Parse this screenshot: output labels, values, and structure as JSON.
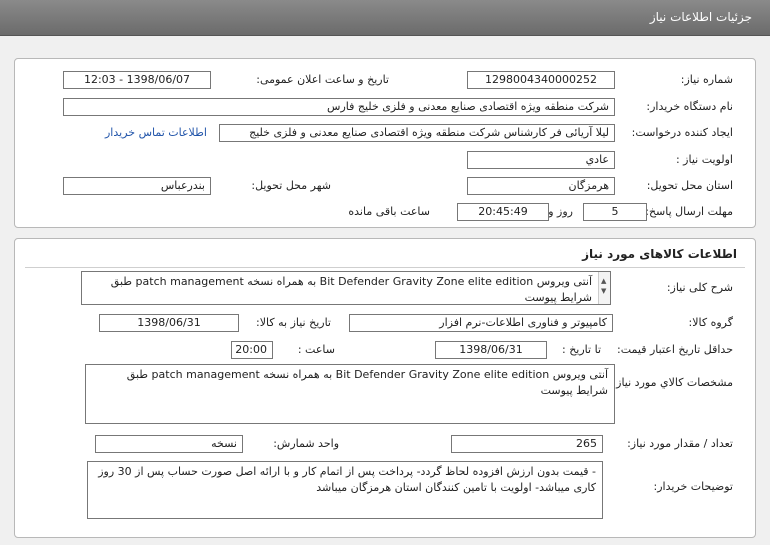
{
  "title": "جزئیات اطلاعات نیاز",
  "need_info": {
    "need_number_label": "شماره نیاز:",
    "need_number": "1298004340000252",
    "announce_label": "تاریخ و ساعت اعلان عمومی:",
    "announce_value": "1398/06/07 - 12:03",
    "buyer_label": "نام دستگاه خریدار:",
    "buyer_value": "شرکت منطقه ویژه اقتصادی صنایع معدنی و فلزی خلیج فارس",
    "creator_label": "ایجاد کننده درخواست:",
    "creator_value": "لیلا آریائی فر کارشناس شرکت منطقه ویژه اقتصادی صنایع معدنی و فلزی خلیج",
    "contact_link": "اطلاعات تماس خریدار",
    "priority_label": "اولویت نیاز :",
    "priority_value": "عادي",
    "province_label": "استان محل تحویل:",
    "province_value": "هرمزگان",
    "city_label": "شهر محل تحویل:",
    "city_value": "بندرعباس",
    "deadline_label": "مهلت ارسال پاسخ:",
    "deadline_days": "5",
    "days_word": "روز و",
    "deadline_time": "20:45:49",
    "remaining_word": "ساعت باقی مانده"
  },
  "goods": {
    "section_title": "اطلاعات کالاهای مورد نیاز",
    "general_desc_label": "شرح کلی نیاز:",
    "general_desc": "آنتی ویروس Bit Defender Gravity Zone elite edition به همراه نسخه patch management طبق شرایط پیوست",
    "group_label": "گروه کالا:",
    "group_value": "کامپیوتر و فناوری اطلاعات-نرم افزار",
    "need_date_label": "تاریخ نیاز به کالا:",
    "need_date": "1398/06/31",
    "min_price_label": "حداقل تاریخ اعتبار قیمت:",
    "until_label": "تا تاریخ :",
    "until_date": "1398/06/31",
    "hour_label": "ساعت :",
    "hour_value": "20:00",
    "spec_label": "مشخصات کالاي مورد نیاز:",
    "spec_value": "آنتی ویروس Bit Defender Gravity Zone elite edition به همراه نسخه patch management طبق شرایط پیوست",
    "qty_label": "تعداد / مقدار مورد نیاز:",
    "qty_value": "265",
    "unit_label": "واحد شمارش:",
    "unit_value": "نسخه",
    "notes_label": "توضیحات خریدار:",
    "notes_value": "- قیمت بدون ارزش افزوده لحاظ گردد- پرداخت پس از اتمام کار و با ارائه اصل صورت حساب پس از 30 روز کاری میباشد- اولویت با تامین کنندگان استان هرمزگان میباشد"
  }
}
